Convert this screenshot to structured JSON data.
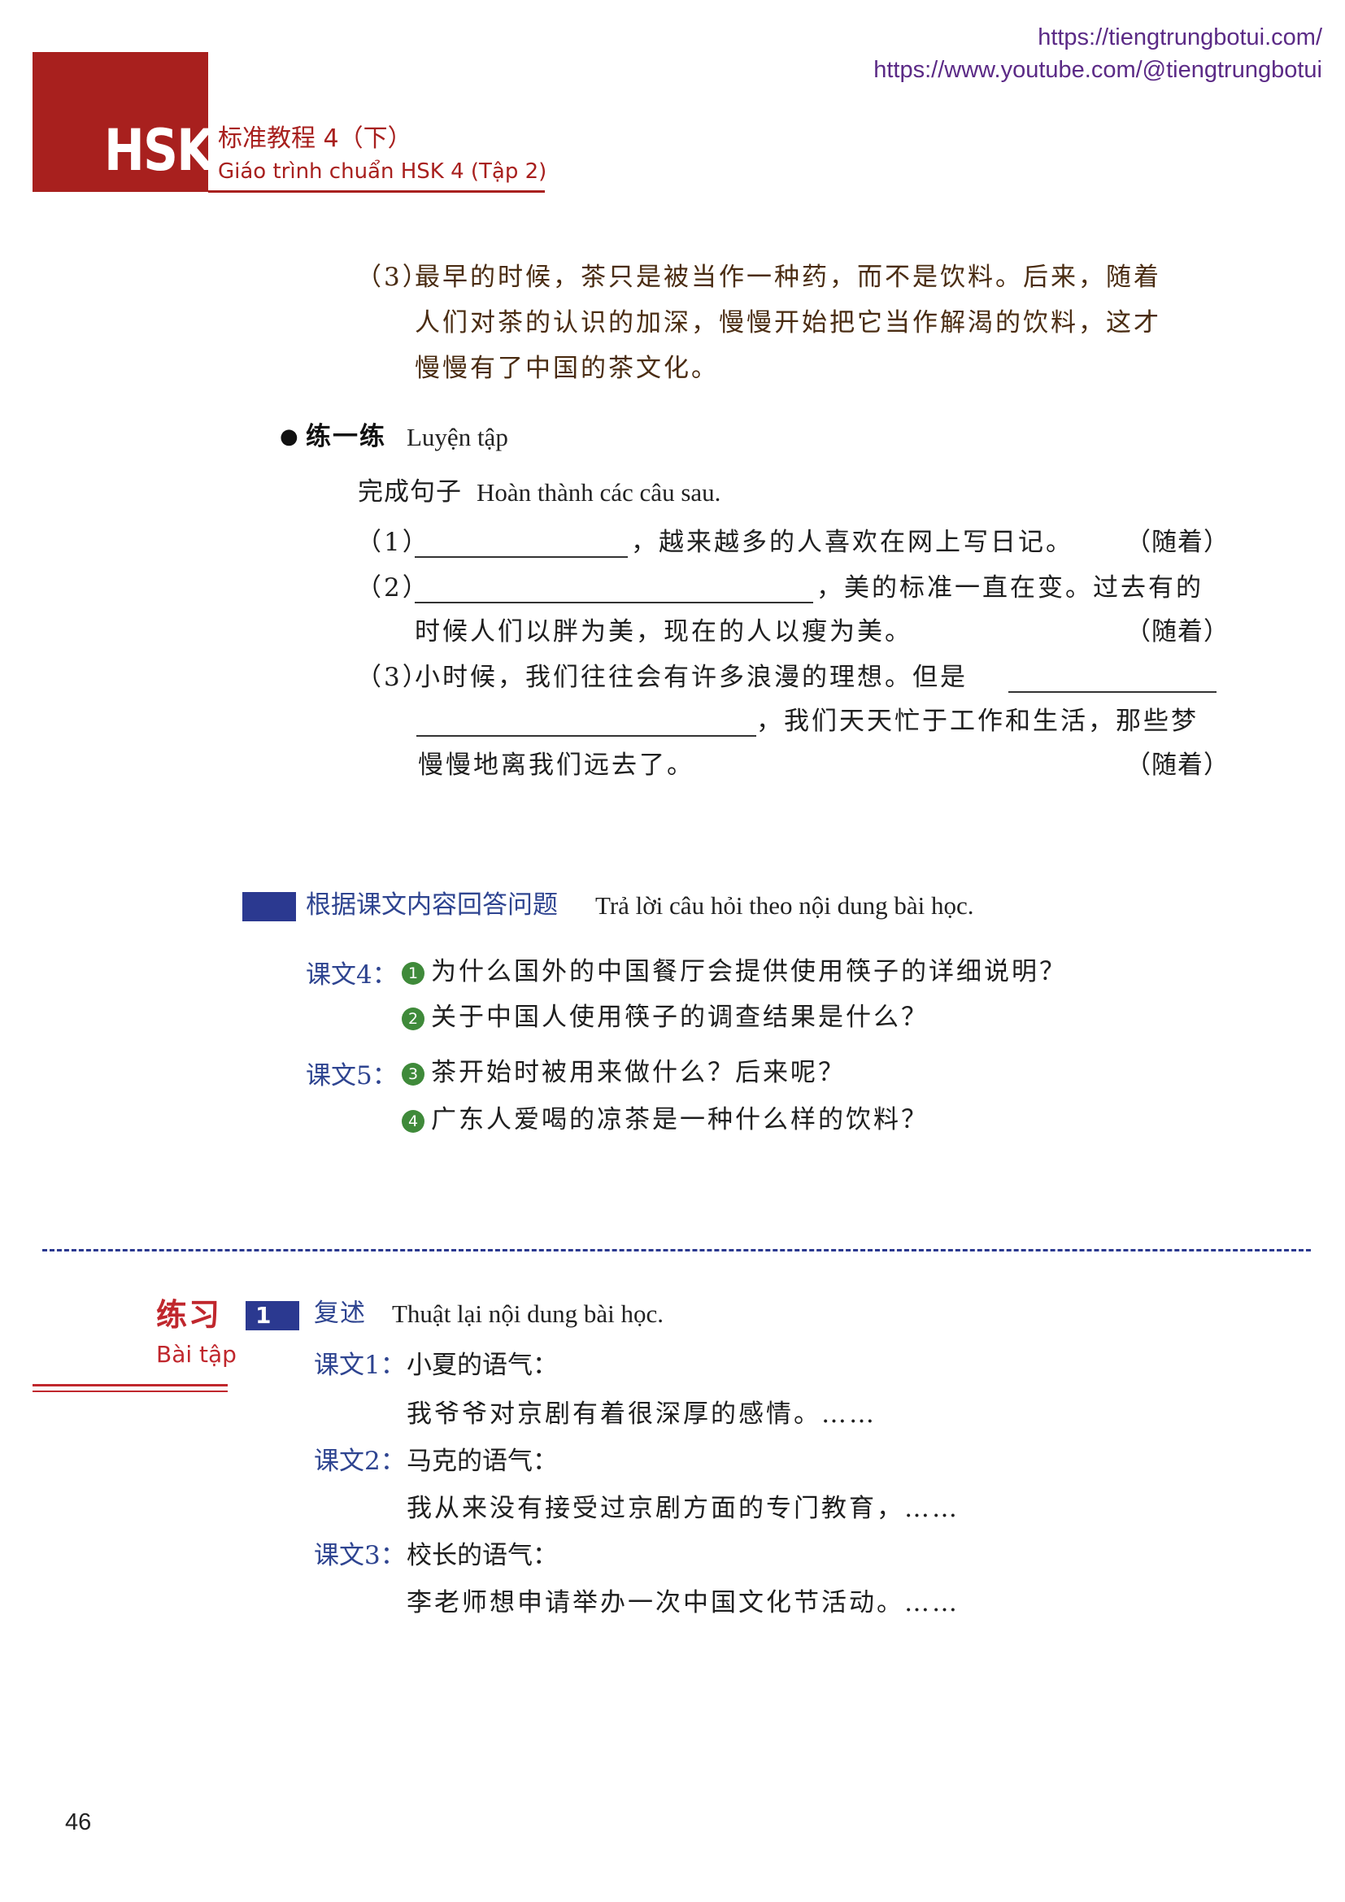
{
  "header": {
    "url1": "https://tiengtrungbotui.com/",
    "url2": "https://www.youtube.com/@tiengtrungbotui",
    "logo": "HSK",
    "book_cn": "标准教程 4（下）",
    "book_vi": "Giáo trình chuẩn HSK 4 (Tập 2)"
  },
  "example3": {
    "num": "（3）",
    "line1": "最早的时候，茶只是被当作一种药，而不是饮料。后来，随着",
    "line2": "人们对茶的认识的加深，慢慢开始把它当作解渴的饮料，这才",
    "line3": "慢慢有了中国的茶文化。"
  },
  "practice": {
    "bullet": "●",
    "title_cn": "练一练",
    "title_vi": "Luyện tập",
    "instr_cn": "完成句子",
    "instr_vi": "Hoàn thành các câu sau.",
    "items": [
      {
        "num": "（1）",
        "after": "，越来越多的人喜欢在网上写日记。",
        "hint": "（随着）"
      },
      {
        "num": "（2）",
        "after": "，美的标准一直在变。过去有的",
        "line2": "时候人们以胖为美，现在的人以瘦为美。",
        "hint": "（随着）"
      },
      {
        "num": "（3）",
        "before": "小时候，我们往往会有许多浪漫的理想。但是",
        "after": "，我们天天忙于工作和生活，那些梦",
        "line3": "慢慢地离我们远去了。",
        "hint": "（随着）"
      }
    ]
  },
  "answer_section": {
    "title_cn": "根据课文内容回答问题",
    "title_vi": "Trả lời câu hỏi theo nội dung bài học.",
    "groups": [
      {
        "label": "课文4：",
        "questions": [
          {
            "n": "1",
            "text": "为什么国外的中国餐厅会提供使用筷子的详细说明？"
          },
          {
            "n": "2",
            "text": "关于中国人使用筷子的调查结果是什么？"
          }
        ]
      },
      {
        "label": "课文5：",
        "questions": [
          {
            "n": "3",
            "text": "茶开始时被用来做什么？后来呢？"
          },
          {
            "n": "4",
            "text": "广东人爱喝的凉茶是一种什么样的饮料？"
          }
        ]
      }
    ]
  },
  "exercise": {
    "title_cn": "练习",
    "title_vi": "Bài tập",
    "number": "1",
    "task_cn": "复述",
    "task_vi": "Thuật lại nội dung bài học.",
    "items": [
      {
        "label": "课文1：",
        "speaker": "小夏的语气：",
        "text": "我爷爷对京剧有着很深厚的感情。……"
      },
      {
        "label": "课文2：",
        "speaker": "马克的语气：",
        "text": "我从来没有接受过京剧方面的专门教育，……"
      },
      {
        "label": "课文3：",
        "speaker": "校长的语气：",
        "text": "李老师想申请举办一次中国文化节活动。……"
      }
    ]
  },
  "page_number": "46",
  "colors": {
    "brand_red": "#a8201e",
    "heading_red": "#c0272d",
    "navy": "#2b3990",
    "link_purple": "#5b2a86",
    "circle_green": "#3f8a3a"
  }
}
